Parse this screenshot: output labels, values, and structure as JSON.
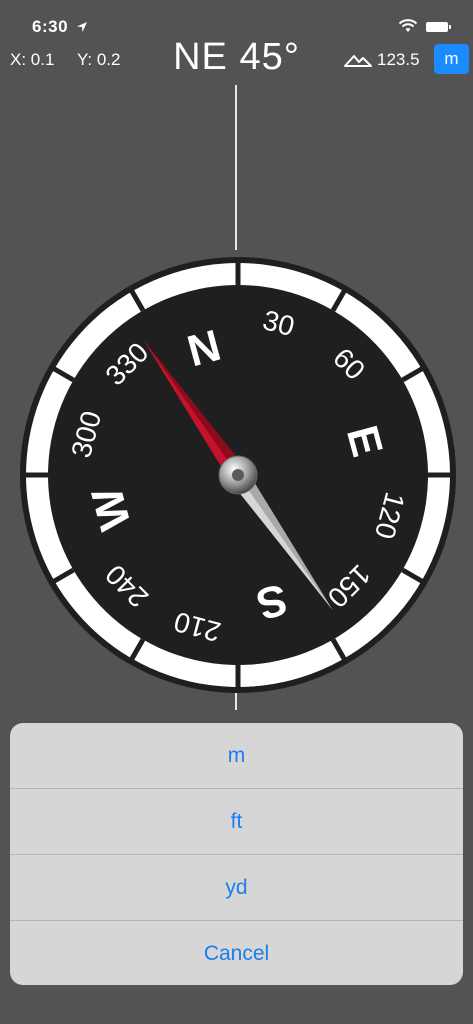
{
  "status_bar": {
    "time": "6:30"
  },
  "coords": {
    "x": "X: 0.1",
    "y": "Y: 0.2"
  },
  "heading": "NE 45°",
  "altitude": {
    "value": "123.5",
    "unit_button": "m"
  },
  "compass": {
    "cardinals": [
      "N",
      "E",
      "S",
      "W"
    ],
    "degree_labels": [
      "30",
      "60",
      "120",
      "150",
      "210",
      "240",
      "300",
      "330"
    ],
    "needle_heading_deg": 45,
    "colors": {
      "needle_north": "#c4132a",
      "needle_south": "#d6d6d6",
      "dial": "#1f1f1f",
      "bezel": "#ffffff"
    }
  },
  "action_sheet": {
    "options": [
      "m",
      "ft",
      "yd"
    ],
    "cancel": "Cancel",
    "accent": "#1d7df0"
  }
}
